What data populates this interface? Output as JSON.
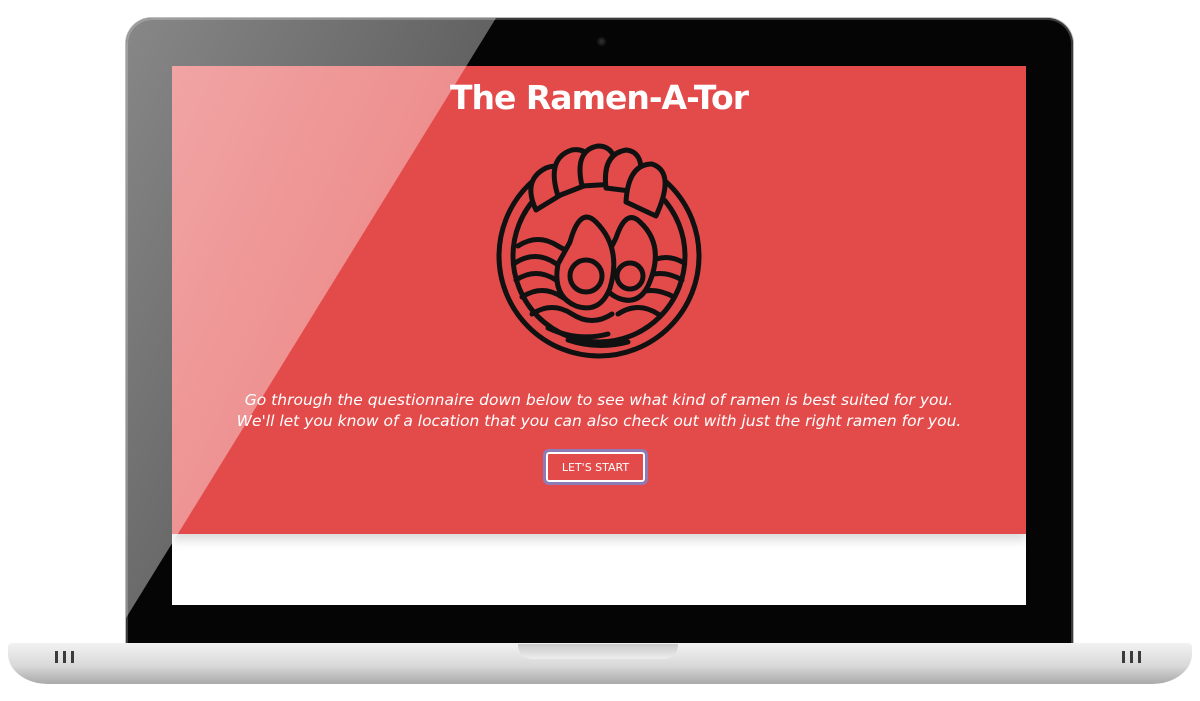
{
  "page": {
    "title": "The Ramen-A-Tor",
    "logo_icon": "ramen-bowl-icon",
    "intro_line1": "Go through the questionnaire down below to see what kind of ramen is best suited for you.",
    "intro_line2": "We'll let you know of a location that you can also check out with just the right ramen for you.",
    "start_button_label": "LET'S START"
  },
  "colors": {
    "hero_background": "#e34b4b",
    "text": "#ffffff",
    "icon_stroke": "#111111",
    "button_focus_ring": "#8d7bb8"
  }
}
